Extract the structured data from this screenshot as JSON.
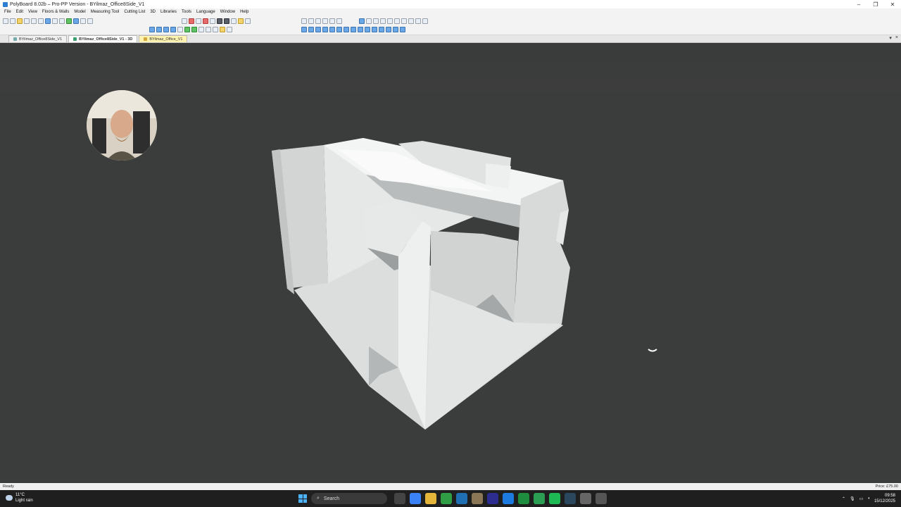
{
  "window": {
    "title": "PolyBoard 8.02b – Pro-PP Version - BYilmaz_Office8Side_V1",
    "controls": [
      "minimize",
      "restore",
      "close"
    ]
  },
  "menu": [
    "File",
    "Edit",
    "View",
    "Floors & Walls",
    "Model",
    "Measuring Tool",
    "Cutting List",
    "3D",
    "Libraries",
    "Tools",
    "Language",
    "Window",
    "Help"
  ],
  "tabs": [
    {
      "label": "BYilmaz_Office8Side_V1",
      "state": "normal"
    },
    {
      "label": "BYilmaz_Office8Side_V1 - 3D",
      "state": "active"
    },
    {
      "label": "BYilmaz_Office_V1",
      "state": "highlight"
    }
  ],
  "tab_controls": [
    "▾",
    "×"
  ],
  "status": {
    "left": "Ready",
    "right": "Price: £75.00"
  },
  "taskbar": {
    "weather_temp": "11°C",
    "weather_desc": "Light rain",
    "search_placeholder": "Search",
    "time": "09:58",
    "date": "15/12/2025"
  },
  "colors": {
    "viewport_bg": "#3b3d3c",
    "model_light": "#e9eaea",
    "model_mid": "#cfd1d1",
    "model_dark": "#a9acac"
  }
}
